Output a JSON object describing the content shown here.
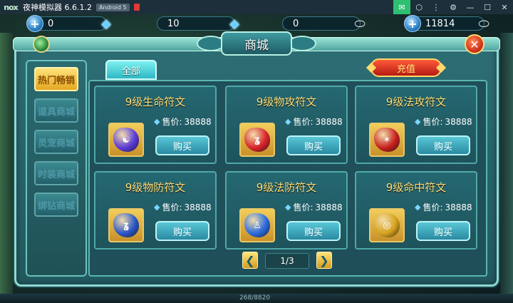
{
  "titlebar": {
    "logo": "nox",
    "title": "夜神模拟器 6.6.1.2",
    "android_badge": "Android 5",
    "icons": [
      "mail-icon",
      "shirt-icon",
      "more-icon",
      "settings-icon",
      "minimize-icon",
      "maximize-icon",
      "close-icon"
    ]
  },
  "resources": [
    {
      "value": "0",
      "pre_icon": "+",
      "post_icon": "diamond-icon"
    },
    {
      "value": "10",
      "post_icon": "bound-diamond-icon"
    },
    {
      "value": "0",
      "post_icon": "silver-ingot-icon"
    },
    {
      "value": "11814",
      "pre_icon": "+",
      "post_icon": "bound-silver-icon"
    }
  ],
  "shop": {
    "title": "商城",
    "close_icon": "close-icon",
    "sidebar": [
      {
        "label": "热门畅销",
        "active": true
      },
      {
        "label": "道具商城",
        "active": false
      },
      {
        "label": "灵宠商城",
        "active": false
      },
      {
        "label": "时装商城",
        "active": false
      },
      {
        "label": "绑钻商城",
        "active": false
      }
    ],
    "tab_all": "全部",
    "recharge_label": "充值",
    "items": [
      {
        "name": "9级生命符文",
        "price_label": "售价:",
        "price": "38888",
        "buy_label": "购买",
        "stone_color": "#5b3bd8",
        "stone_glyph": "☯"
      },
      {
        "name": "9级物攻符文",
        "price_label": "售价:",
        "price": "38888",
        "buy_label": "购买",
        "stone_color": "#d8232a",
        "stone_glyph": "ʓ"
      },
      {
        "name": "9级法攻符文",
        "price_label": "售价:",
        "price": "38888",
        "buy_label": "购买",
        "stone_color": "#c8201e",
        "stone_glyph": "✶"
      },
      {
        "name": "9级物防符文",
        "price_label": "售价:",
        "price": "38888",
        "buy_label": "购买",
        "stone_color": "#2b57c8",
        "stone_glyph": "ʓ"
      },
      {
        "name": "9级法防符文",
        "price_label": "售价:",
        "price": "38888",
        "buy_label": "购买",
        "stone_color": "#2a6be0",
        "stone_glyph": "♙"
      },
      {
        "name": "9级命中符文",
        "price_label": "售价:",
        "price": "38888",
        "buy_label": "购买",
        "stone_color": "#d7a21d",
        "stone_glyph": "◎"
      }
    ],
    "pager": {
      "label": "1/3",
      "prev_icon": "prev-arrow-icon",
      "next_icon": "next-arrow-icon"
    }
  },
  "bottom": {
    "hp_text": "268/8820"
  }
}
